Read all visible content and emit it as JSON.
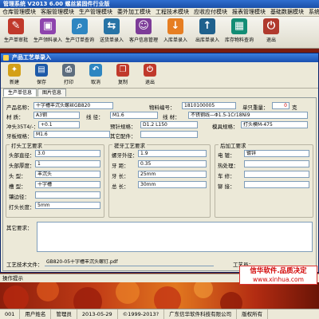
{
  "app": {
    "title": "管理系统  V2013  6.00  螺丝紧固件行业版",
    "menu": [
      "仓库管理模块",
      "客服管理模块",
      "生产管理模块",
      "委外加工模块",
      "工程技术模块",
      "应收应付模块",
      "报表管理模块",
      "基础数据模块",
      "系统功能"
    ]
  },
  "toolbar": [
    {
      "label": "生产单审批",
      "icon": "approve-icon",
      "color": "#c0392b",
      "glyph": "✎"
    },
    {
      "label": "生产领料录入",
      "icon": "material-icon",
      "color": "#8e44ad",
      "glyph": "▣"
    },
    {
      "label": "生产订单查询",
      "icon": "order-query-icon",
      "color": "#2e86c1",
      "glyph": "⌕"
    },
    {
      "label": "送货单录入",
      "icon": "delivery-icon",
      "color": "#2874a6",
      "glyph": "⇆"
    },
    {
      "label": "客户信息管理",
      "icon": "customer-icon",
      "color": "#7d3c98",
      "glyph": "☺"
    },
    {
      "label": "入库单录入",
      "icon": "stock-in-icon",
      "color": "#e67e22",
      "glyph": "↓"
    },
    {
      "label": "出库单录入",
      "icon": "stock-out-icon",
      "color": "#1f618d",
      "glyph": "↑"
    },
    {
      "label": "库存物料查询",
      "icon": "inventory-icon",
      "color": "#138d75",
      "glyph": "▦"
    },
    {
      "label": "退出",
      "icon": "exit-icon",
      "color": "#b03a2e",
      "glyph": "⏻"
    }
  ],
  "window": {
    "title": "产品工艺单录入",
    "buttons": [
      {
        "label": "新建",
        "icon": "new-icon",
        "color": "#d4a017",
        "glyph": "✦"
      },
      {
        "label": "保存",
        "icon": "save-icon",
        "color": "#1e5aa8",
        "glyph": "▤"
      },
      {
        "label": "打印",
        "icon": "print-icon",
        "color": "#5d6d7e",
        "glyph": "⎙"
      },
      {
        "label": "取消",
        "icon": "cancel-icon",
        "color": "#2e86c1",
        "glyph": "↶"
      },
      {
        "label": "复制",
        "icon": "copy-icon",
        "color": "#c0392b",
        "glyph": "❐"
      },
      {
        "label": "退出",
        "icon": "exit-icon",
        "color": "#c0392b",
        "glyph": "⏻"
      }
    ],
    "tabs": [
      "生产单信息",
      "图片信息"
    ]
  },
  "form": {
    "product_name_label": "产品名称：",
    "product_name": "十字槽丰沉头螺丝GB820",
    "material_no_label": "物料编号：",
    "material_no": "1810100005",
    "unit_weight_label": "单只重量：",
    "unit_weight": "0",
    "unit_weight_unit": "克",
    "material_label": "材    质：",
    "material": "A3钢",
    "wire_label": "线    径：",
    "wire": "M1.6",
    "steel_label": "线    材：",
    "steel": "不锈钢线—Φ1.5-1Cr18Ni9",
    "punch_label": "冲头35T4/-：",
    "punch": "+0.1",
    "preform_label": "预针规格：",
    "preform": "D1.2 L150",
    "die_label": "模具规格：",
    "die": "打头模M-475",
    "tooth_label": "牙板规格：",
    "tooth": "M1.6",
    "other_label": "其它配件："
  },
  "group_head": {
    "title": "打头工艺要求",
    "fields": [
      {
        "label": "头部直径：",
        "value": "3.0"
      },
      {
        "label": "头部厚度：",
        "value": "1"
      },
      {
        "label": "头    型：",
        "value": "丰沉头"
      },
      {
        "label": "槽    型：",
        "value": "十字槽"
      },
      {
        "label": "镶边径：",
        "value": ""
      },
      {
        "label": "打头长度：",
        "value": "5mm"
      }
    ]
  },
  "group_thread": {
    "title": "搓牙工艺要求",
    "fields": [
      {
        "label": "螺牙外径：",
        "value": "1.9"
      },
      {
        "label": "牙    距：",
        "value": "0.35"
      },
      {
        "label": "牙    长：",
        "value": "25mm"
      },
      {
        "label": "总    长：",
        "value": "30mm"
      }
    ]
  },
  "group_post": {
    "title": "后加工要求",
    "fields": [
      {
        "label": "电    镀：",
        "value": "镀锌"
      },
      {
        "label": "热处理：",
        "value": ""
      },
      {
        "label": "车    修：",
        "value": ""
      },
      {
        "label": "铆    接：",
        "value": ""
      }
    ]
  },
  "other_req_label": "其它要求：",
  "file_label": "工艺技术文件：",
  "file_value": "GB820-05十字槽丰沉头螺钉.pdf",
  "craftsman_label": "工艺员：",
  "status_hint": "操作提示",
  "promo": {
    "line1": "信华软件.品质决定",
    "line2": "www.xinhua.com"
  },
  "statusbar": [
    "001",
    "用户姓名",
    "管理员",
    "2013-05-29",
    "©1999-2013?",
    "广东信华软件科技有限公司",
    "版权所有"
  ]
}
